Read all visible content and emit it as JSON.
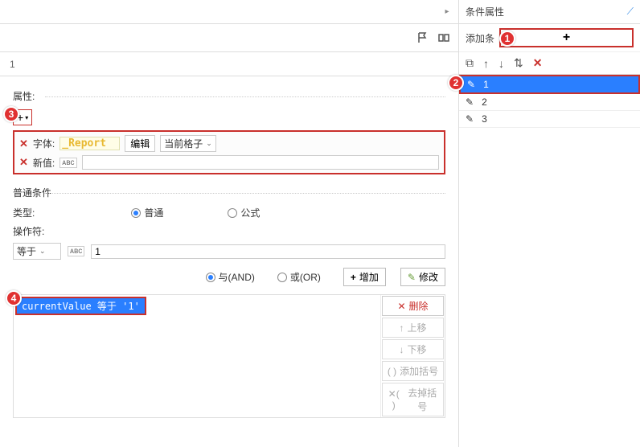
{
  "left": {
    "row_one": "1",
    "props_label": "属性:",
    "font_row": {
      "label": "字体:",
      "preview": "_Report",
      "edit_btn": "编辑",
      "scope_sel": "当前格子"
    },
    "newval_row": {
      "label": "新值:",
      "value": ""
    },
    "cond_label": "普通条件",
    "type_label": "类型:",
    "type_normal": "普通",
    "type_formula": "公式",
    "op_label": "操作符:",
    "op_value": "等于",
    "val_value": "1",
    "and_label": "与(AND)",
    "or_label": "或(OR)",
    "add_btn": "增加",
    "mod_btn": "修改",
    "list_item": "currentValue 等于 '1'",
    "actions": {
      "delete": "删除",
      "up": "上移",
      "down": "下移",
      "addparen": "添加括号",
      "delparen": "去掉括号"
    }
  },
  "right": {
    "title": "条件属性",
    "add_label": "添加条",
    "items": [
      "1",
      "2",
      "3"
    ]
  },
  "badges": {
    "b1": "1",
    "b2": "2",
    "b3": "3",
    "b4": "4"
  }
}
